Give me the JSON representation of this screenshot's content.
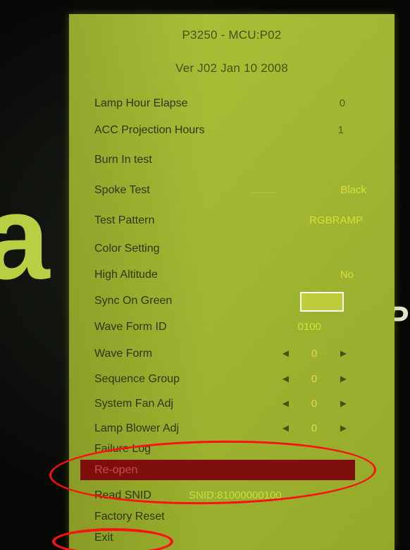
{
  "osd": {
    "title_line1": "P3250 - MCU:P02",
    "title_line2": "Ver J02 Jan 10 2008",
    "items": [
      {
        "label": "Lamp Hour Elapse",
        "value": "0"
      },
      {
        "label": "ACC Projection Hours",
        "value": "1"
      },
      {
        "label": "Burn In test"
      },
      {
        "label": "Spoke Test",
        "value": "Black"
      },
      {
        "label": "Test Pattern",
        "value": "RGBRAMP"
      },
      {
        "label": "Color Setting"
      },
      {
        "label": "High Altitude",
        "value": "No"
      },
      {
        "label": "Sync On Green"
      },
      {
        "label": "Wave Form ID",
        "value": "0100"
      },
      {
        "label": "Wave Form",
        "value": "0"
      },
      {
        "label": "Sequence Group",
        "value": "0"
      },
      {
        "label": "System Fan Adj",
        "value": "0"
      },
      {
        "label": "Lamp Blower Adj",
        "value": "0"
      },
      {
        "label": "Failure Log"
      },
      {
        "label": "Re-open"
      },
      {
        "label": "Read SNID",
        "value": "SNID:81000000100"
      },
      {
        "label": "Factory Reset"
      },
      {
        "label": "Exit"
      }
    ]
  },
  "background": {
    "left_fragment": "a",
    "right_fragment": "g P"
  },
  "colors": {
    "osd_green": "#a5bc30",
    "selection_red": "#7f0f0d",
    "annotation_red": "#ff1010"
  }
}
